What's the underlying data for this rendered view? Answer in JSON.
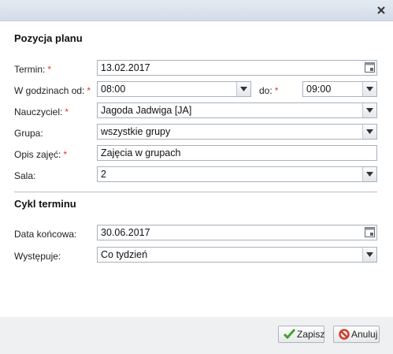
{
  "section_plan": {
    "title": "Pozycja planu"
  },
  "fields": {
    "termin": {
      "label": "Termin:",
      "value": "13.02.2017"
    },
    "godziny_od": {
      "label": "W godzinach od:",
      "value": "08:00"
    },
    "godziny_do": {
      "label": "do:",
      "value": "09:00"
    },
    "nauczyciel": {
      "label": "Nauczyciel:",
      "value": "Jagoda Jadwiga [JA]"
    },
    "grupa": {
      "label": "Grupa:",
      "value": "wszystkie grupy"
    },
    "opis": {
      "label": "Opis zajęć:",
      "value": "Zajęcia w grupach"
    },
    "sala": {
      "label": "Sala:",
      "value": "2"
    }
  },
  "section_cykl": {
    "title": "Cykl terminu"
  },
  "cykl": {
    "data_koncowa": {
      "label": "Data końcowa:",
      "value": "30.06.2017"
    },
    "wystepuje": {
      "label": "Występuje:",
      "value": "Co tydzień"
    }
  },
  "required_marker": "*",
  "buttons": {
    "save": "Zapisz",
    "cancel": "Anuluj"
  },
  "icons": {
    "close": "close-icon",
    "calendar": "calendar-icon",
    "dropdown": "chevron-down-icon",
    "save": "checkmark-icon",
    "cancel": "cancel-icon"
  },
  "colors": {
    "required": "#ee3333",
    "save_check": "#4aa02c",
    "cancel_icon": "#d23a2a"
  }
}
